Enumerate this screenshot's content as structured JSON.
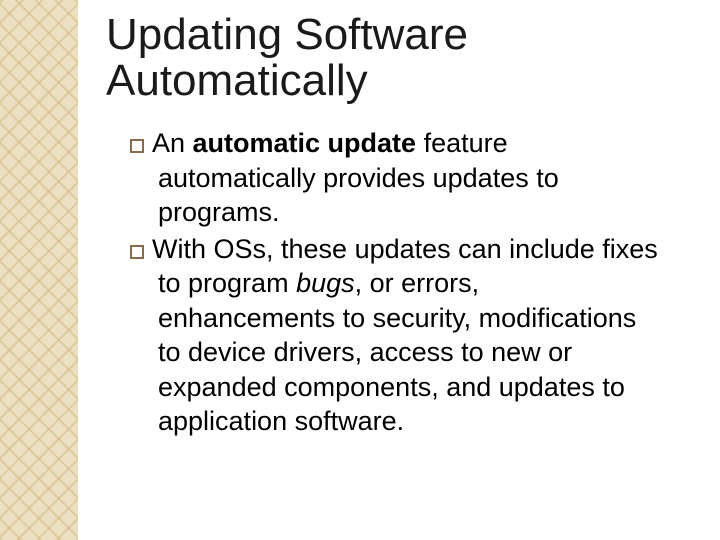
{
  "slide": {
    "title": "Updating Software Automatically",
    "bullets": [
      {
        "pre": "An ",
        "bold": "automatic update",
        "post": " feature automatically provides updates to programs."
      },
      {
        "pre": "With OSs, these updates can include fixes to program ",
        "italic": "bugs",
        "post": ", or errors, enhancements to security, modifications to device drivers, access to new or expanded components, and updates to application software."
      }
    ]
  }
}
